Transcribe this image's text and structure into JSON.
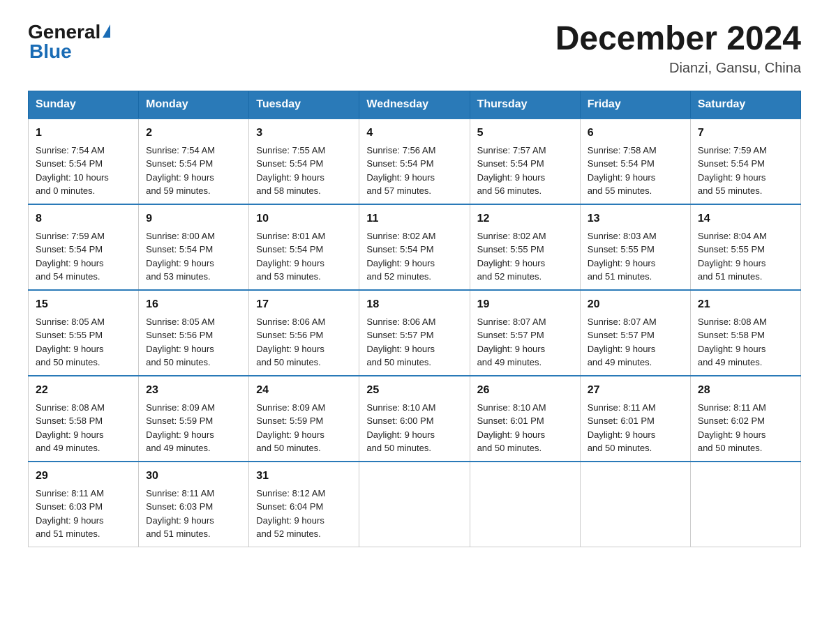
{
  "logo": {
    "general": "General",
    "blue": "Blue",
    "triangle": "▶"
  },
  "title": "December 2024",
  "subtitle": "Dianzi, Gansu, China",
  "days_header": [
    "Sunday",
    "Monday",
    "Tuesday",
    "Wednesday",
    "Thursday",
    "Friday",
    "Saturday"
  ],
  "weeks": [
    [
      {
        "day": "1",
        "sunrise": "7:54 AM",
        "sunset": "5:54 PM",
        "daylight": "10 hours and 0 minutes."
      },
      {
        "day": "2",
        "sunrise": "7:54 AM",
        "sunset": "5:54 PM",
        "daylight": "9 hours and 59 minutes."
      },
      {
        "day": "3",
        "sunrise": "7:55 AM",
        "sunset": "5:54 PM",
        "daylight": "9 hours and 58 minutes."
      },
      {
        "day": "4",
        "sunrise": "7:56 AM",
        "sunset": "5:54 PM",
        "daylight": "9 hours and 57 minutes."
      },
      {
        "day": "5",
        "sunrise": "7:57 AM",
        "sunset": "5:54 PM",
        "daylight": "9 hours and 56 minutes."
      },
      {
        "day": "6",
        "sunrise": "7:58 AM",
        "sunset": "5:54 PM",
        "daylight": "9 hours and 55 minutes."
      },
      {
        "day": "7",
        "sunrise": "7:59 AM",
        "sunset": "5:54 PM",
        "daylight": "9 hours and 55 minutes."
      }
    ],
    [
      {
        "day": "8",
        "sunrise": "7:59 AM",
        "sunset": "5:54 PM",
        "daylight": "9 hours and 54 minutes."
      },
      {
        "day": "9",
        "sunrise": "8:00 AM",
        "sunset": "5:54 PM",
        "daylight": "9 hours and 53 minutes."
      },
      {
        "day": "10",
        "sunrise": "8:01 AM",
        "sunset": "5:54 PM",
        "daylight": "9 hours and 53 minutes."
      },
      {
        "day": "11",
        "sunrise": "8:02 AM",
        "sunset": "5:54 PM",
        "daylight": "9 hours and 52 minutes."
      },
      {
        "day": "12",
        "sunrise": "8:02 AM",
        "sunset": "5:55 PM",
        "daylight": "9 hours and 52 minutes."
      },
      {
        "day": "13",
        "sunrise": "8:03 AM",
        "sunset": "5:55 PM",
        "daylight": "9 hours and 51 minutes."
      },
      {
        "day": "14",
        "sunrise": "8:04 AM",
        "sunset": "5:55 PM",
        "daylight": "9 hours and 51 minutes."
      }
    ],
    [
      {
        "day": "15",
        "sunrise": "8:05 AM",
        "sunset": "5:55 PM",
        "daylight": "9 hours and 50 minutes."
      },
      {
        "day": "16",
        "sunrise": "8:05 AM",
        "sunset": "5:56 PM",
        "daylight": "9 hours and 50 minutes."
      },
      {
        "day": "17",
        "sunrise": "8:06 AM",
        "sunset": "5:56 PM",
        "daylight": "9 hours and 50 minutes."
      },
      {
        "day": "18",
        "sunrise": "8:06 AM",
        "sunset": "5:57 PM",
        "daylight": "9 hours and 50 minutes."
      },
      {
        "day": "19",
        "sunrise": "8:07 AM",
        "sunset": "5:57 PM",
        "daylight": "9 hours and 49 minutes."
      },
      {
        "day": "20",
        "sunrise": "8:07 AM",
        "sunset": "5:57 PM",
        "daylight": "9 hours and 49 minutes."
      },
      {
        "day": "21",
        "sunrise": "8:08 AM",
        "sunset": "5:58 PM",
        "daylight": "9 hours and 49 minutes."
      }
    ],
    [
      {
        "day": "22",
        "sunrise": "8:08 AM",
        "sunset": "5:58 PM",
        "daylight": "9 hours and 49 minutes."
      },
      {
        "day": "23",
        "sunrise": "8:09 AM",
        "sunset": "5:59 PM",
        "daylight": "9 hours and 49 minutes."
      },
      {
        "day": "24",
        "sunrise": "8:09 AM",
        "sunset": "5:59 PM",
        "daylight": "9 hours and 50 minutes."
      },
      {
        "day": "25",
        "sunrise": "8:10 AM",
        "sunset": "6:00 PM",
        "daylight": "9 hours and 50 minutes."
      },
      {
        "day": "26",
        "sunrise": "8:10 AM",
        "sunset": "6:01 PM",
        "daylight": "9 hours and 50 minutes."
      },
      {
        "day": "27",
        "sunrise": "8:11 AM",
        "sunset": "6:01 PM",
        "daylight": "9 hours and 50 minutes."
      },
      {
        "day": "28",
        "sunrise": "8:11 AM",
        "sunset": "6:02 PM",
        "daylight": "9 hours and 50 minutes."
      }
    ],
    [
      {
        "day": "29",
        "sunrise": "8:11 AM",
        "sunset": "6:03 PM",
        "daylight": "9 hours and 51 minutes."
      },
      {
        "day": "30",
        "sunrise": "8:11 AM",
        "sunset": "6:03 PM",
        "daylight": "9 hours and 51 minutes."
      },
      {
        "day": "31",
        "sunrise": "8:12 AM",
        "sunset": "6:04 PM",
        "daylight": "9 hours and 52 minutes."
      },
      null,
      null,
      null,
      null
    ]
  ],
  "sunrise_label": "Sunrise:",
  "sunset_label": "Sunset:",
  "daylight_label": "Daylight:"
}
